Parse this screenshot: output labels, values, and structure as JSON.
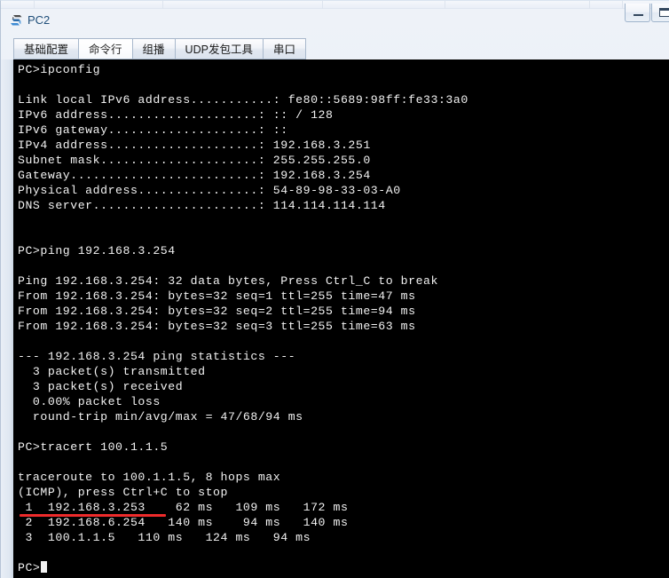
{
  "window": {
    "title": "PC2",
    "icon": "pc-device-icon",
    "controls": [
      {
        "name": "minimize-button",
        "icon": "minimize-icon",
        "label": ""
      },
      {
        "name": "maximize-button",
        "icon": "maximize-icon",
        "label": ""
      }
    ]
  },
  "tabs": [
    {
      "label": "基础配置",
      "active": false,
      "name": "tab-basic-config"
    },
    {
      "label": "命令行",
      "active": true,
      "name": "tab-command-line"
    },
    {
      "label": "组播",
      "active": false,
      "name": "tab-multicast"
    },
    {
      "label": "UDP发包工具",
      "active": false,
      "name": "tab-udp-packet-tool"
    },
    {
      "label": "串口",
      "active": false,
      "name": "tab-serial-port"
    }
  ],
  "terminal": {
    "prompt": "PC>",
    "content": "PC>ipconfig\n\nLink local IPv6 address...........: fe80::5689:98ff:fe33:3a0\nIPv6 address....................: :: / 128\nIPv6 gateway....................: ::\nIPv4 address....................: 192.168.3.251\nSubnet mask.....................: 255.255.255.0\nGateway.........................: 192.168.3.254\nPhysical address................: 54-89-98-33-03-A0\nDNS server......................: 114.114.114.114\n\n\nPC>ping 192.168.3.254\n\nPing 192.168.3.254: 32 data bytes, Press Ctrl_C to break\nFrom 192.168.3.254: bytes=32 seq=1 ttl=255 time=47 ms\nFrom 192.168.3.254: bytes=32 seq=2 ttl=255 time=94 ms\nFrom 192.168.3.254: bytes=32 seq=3 ttl=255 time=63 ms\n\n--- 192.168.3.254 ping statistics ---\n  3 packet(s) transmitted\n  3 packet(s) received\n  0.00% packet loss\n  round-trip min/avg/max = 47/68/94 ms\n\nPC>tracert 100.1.1.5\n\ntraceroute to 100.1.1.5, 8 hops max\n(ICMP), press Ctrl+C to stop\n 1  192.168.3.253    62 ms   109 ms   172 ms\n 2  192.168.6.254   140 ms    94 ms   140 ms\n 3  100.1.1.5   110 ms   124 ms   94 ms\n\n",
    "commands": [
      {
        "command": "ipconfig",
        "prompt": "PC>"
      },
      {
        "command": "ping 192.168.3.254",
        "prompt": "PC>"
      },
      {
        "command": "tracert 100.1.1.5",
        "prompt": "PC>"
      }
    ],
    "ipconfig_result": {
      "link_local_ipv6_address": "fe80::5689:98ff:fe33:3a0",
      "ipv6_address": ":: / 128",
      "ipv6_gateway": "::",
      "ipv4_address": "192.168.3.251",
      "subnet_mask": "255.255.255.0",
      "gateway": "192.168.3.254",
      "physical_address": "54-89-98-33-03-A0",
      "dns_server": "114.114.114.114"
    },
    "ping_result": {
      "header": "Ping 192.168.3.254: 32 data bytes, Press Ctrl_C to break",
      "replies": [
        "From 192.168.3.254: bytes=32 seq=1 ttl=255 time=47 ms",
        "From 192.168.3.254: bytes=32 seq=2 ttl=255 time=94 ms",
        "From 192.168.3.254: bytes=32 seq=3 ttl=255 time=63 ms"
      ],
      "statistics_title": "--- 192.168.3.254 ping statistics ---",
      "transmitted": "3 packet(s) transmitted",
      "received": "3 packet(s) received",
      "loss": "0.00% packet loss",
      "round_trip": "round-trip min/avg/max = 47/68/94 ms"
    },
    "tracert_result": {
      "header": "traceroute to 100.1.1.5, 8 hops max",
      "subheader": "(ICMP), press Ctrl+C to stop",
      "hops": [
        {
          "hop": "1",
          "address": "192.168.3.253",
          "t1": "62 ms",
          "t2": "109 ms",
          "t3": "172 ms"
        },
        {
          "hop": "2",
          "address": "192.168.6.254",
          "t1": "140 ms",
          "t2": "94 ms",
          "t3": "140 ms"
        },
        {
          "hop": "3",
          "address": "100.1.1.5",
          "t1": "110 ms",
          "t2": "124 ms",
          "t3": "94 ms"
        }
      ]
    }
  },
  "annotation": {
    "color": "#ee2b2b",
    "underlines_text": "1  192.168.3.253"
  },
  "colors": {
    "terminal_background": "#000000",
    "terminal_text": "#f2f2f2",
    "title_text": "#1f4e79",
    "chrome": "#e8eef6",
    "annotation_red": "#ee2b2b"
  }
}
